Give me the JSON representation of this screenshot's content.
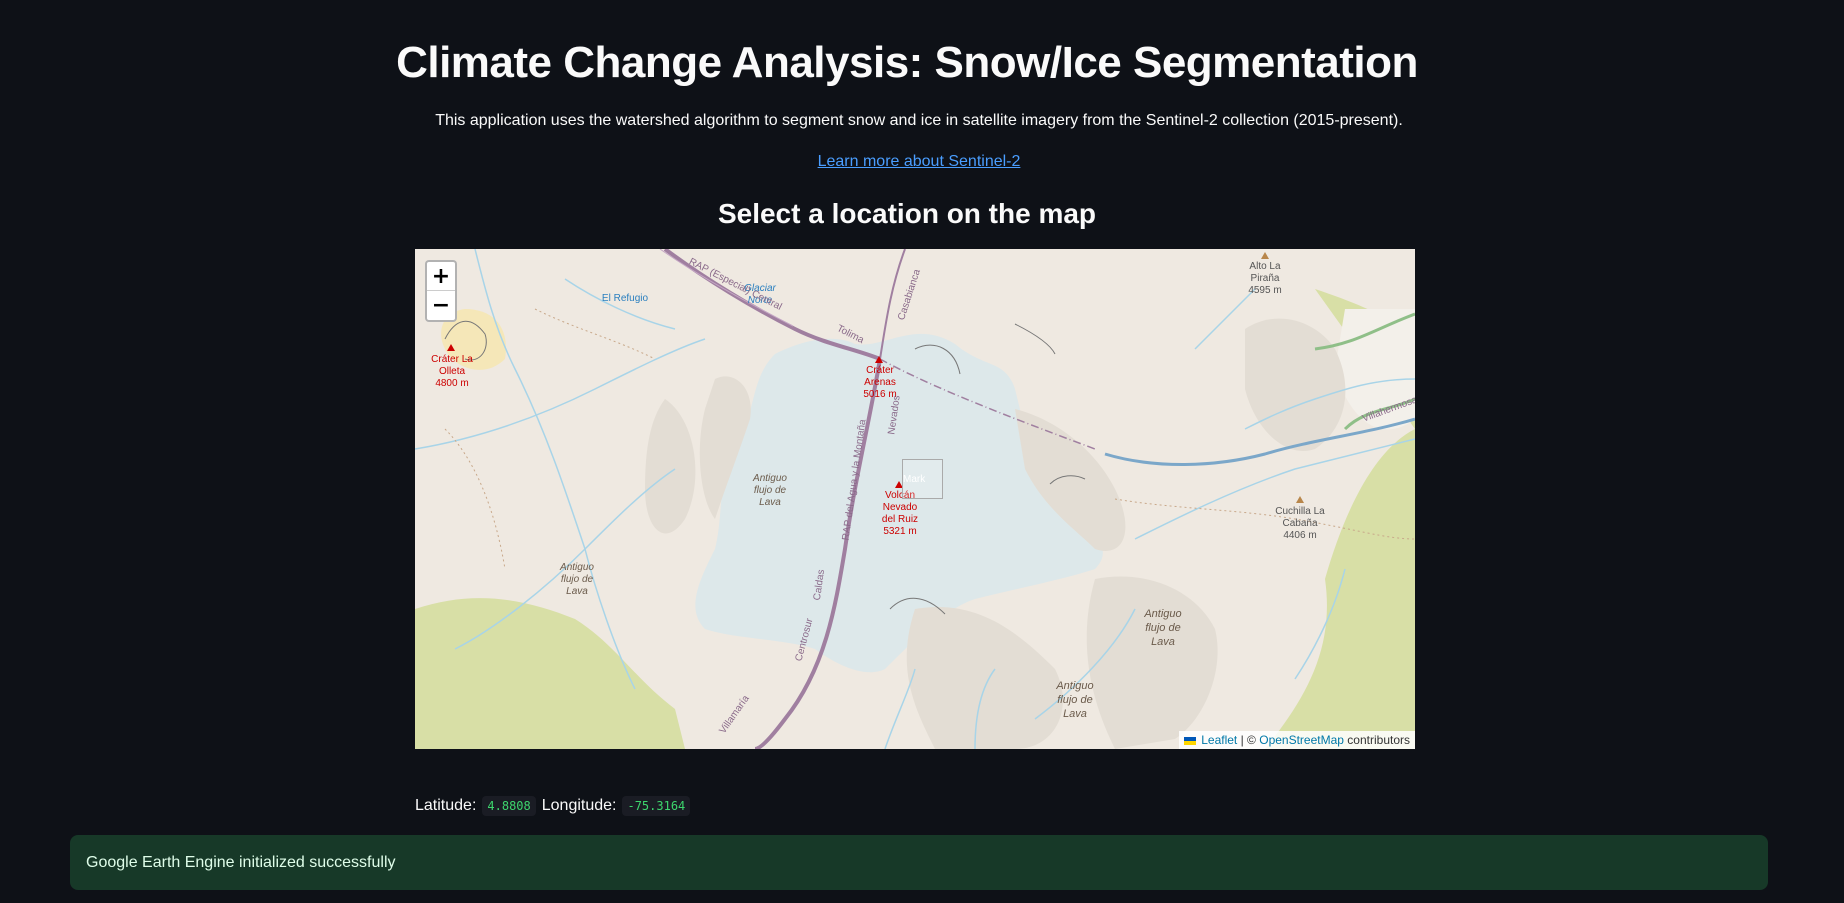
{
  "header": {
    "title": "Climate Change Analysis: Snow/Ice Segmentation",
    "intro": "This application uses the watershed algorithm to segment snow and ice in satellite imagery from the Sentinel-2 collection (2015-present).",
    "link_text": "Learn more about Sentinel-2",
    "subtitle": "Select a location on the map"
  },
  "map": {
    "zoom_in": "+",
    "zoom_out": "−",
    "attribution": {
      "leaflet": "Leaflet",
      "separator": "| ©",
      "osm": "OpenStreetMap",
      "contributors": "contributors"
    },
    "marker_alt": "Mark",
    "labels": {
      "el_refugio": "El Refugio",
      "glaciar_norte": "Glaciar Norte",
      "crater_olleta": "Cráter La Olleta 4800 m",
      "crater_arenas": "Cráter Arenas 5016 m",
      "volcan_ruiz": "Volcán Nevado del Ruiz 5321 m",
      "alto_pirana": "Alto La Piraña 4595 m",
      "cuchilla_cabana": "Cuchilla La Cabaña 4406 m",
      "lava_1": "Antiguo flujo de Lava",
      "lava_2": "Antiguo flujo de Lava",
      "lava_3": "Antiguo flujo de Lava",
      "lava_4": "Antiguo flujo de Lava",
      "road_rap_central": "RAP (Especial) Central",
      "road_tolima": "Tolima",
      "road_casabianca": "Casabianca",
      "road_nevados": "Nevados",
      "road_rap_agua": "RAP del Agua y la Montaña",
      "road_caldas": "Caldas",
      "road_centrosur": "Centrosur",
      "road_villamaria": "Villamaría",
      "road_villahermosa": "Villahermosa"
    },
    "colors": {
      "terrain": "#efe9e1",
      "glacier": "#dde8ea",
      "grass": "#d8dfa6",
      "water": "#a8d4e8",
      "road": "#a07fa0"
    }
  },
  "coordinates": {
    "lat_label": "Latitude:",
    "lat_value": "4.8808",
    "lon_label": "Longitude:",
    "lon_value": "-75.3164"
  },
  "status": {
    "message": "Google Earth Engine initialized successfully",
    "color": "#173928"
  }
}
